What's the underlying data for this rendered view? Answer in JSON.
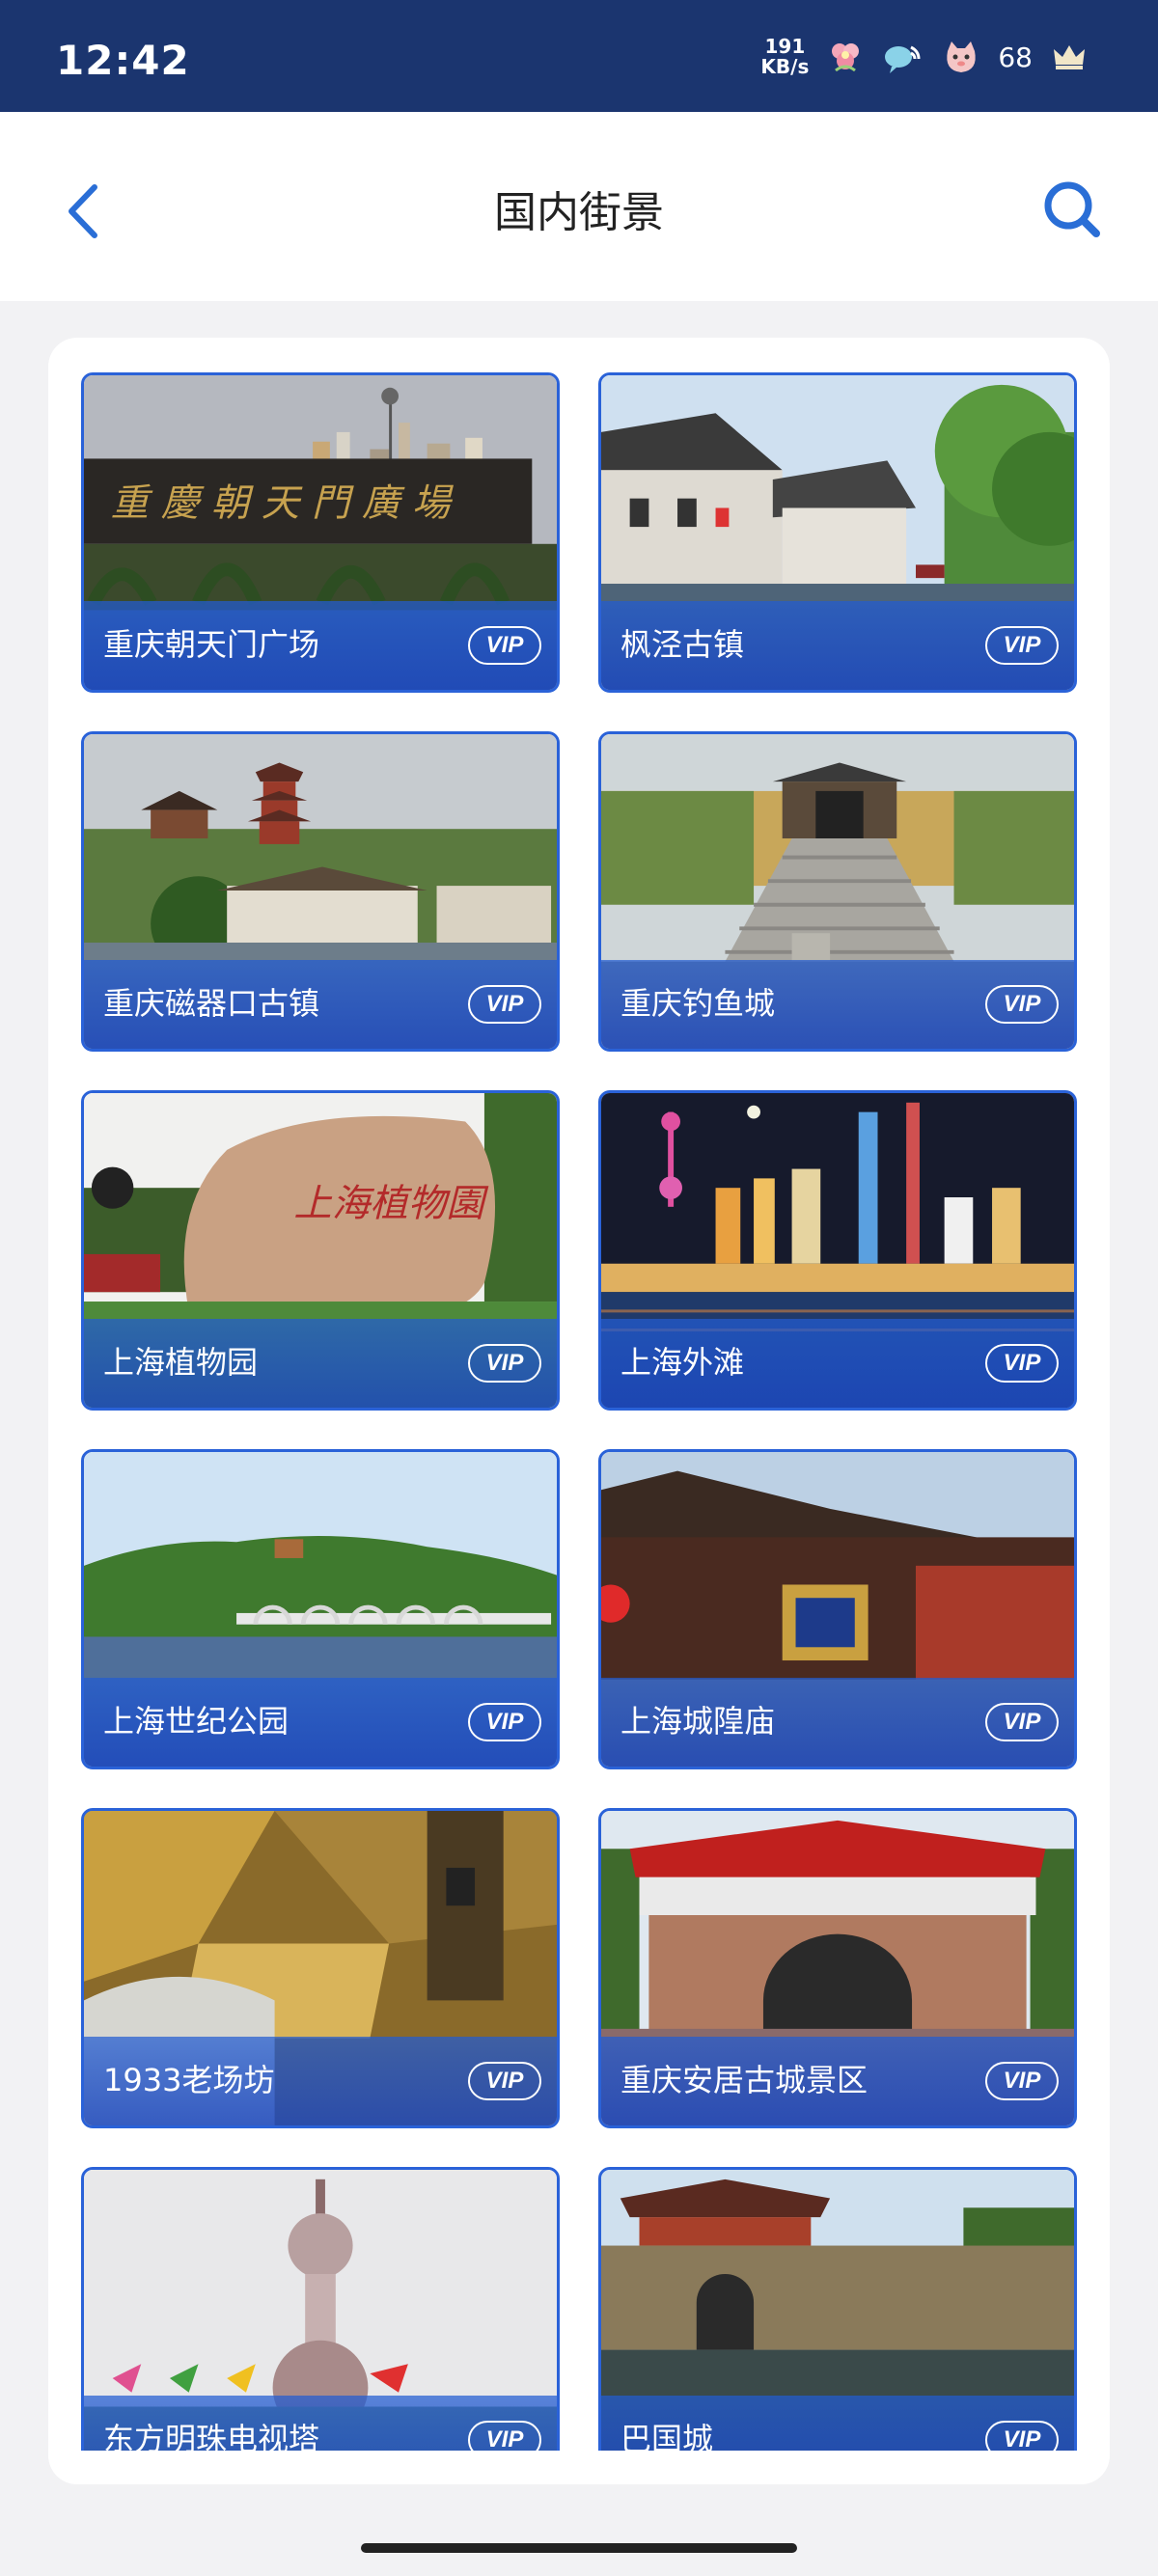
{
  "status_bar": {
    "time": "12:42",
    "net_speed_value": "191",
    "net_speed_unit": "KB/s",
    "battery": "68",
    "icons": [
      "flower-notification-icon",
      "chat-wifi-icon",
      "cat-app-icon",
      "crown-icon"
    ]
  },
  "header": {
    "title": "国内街景",
    "back_icon": "chevron-left-icon",
    "search_icon": "search-icon"
  },
  "vip_label": "VIP",
  "cards": [
    {
      "title": "重庆朝天门广场",
      "scene": "plaza"
    },
    {
      "title": "枫泾古镇",
      "scene": "watertown"
    },
    {
      "title": "重庆磁器口古镇",
      "scene": "pagoda"
    },
    {
      "title": "重庆钓鱼城",
      "scene": "gate-stairs"
    },
    {
      "title": "上海植物园",
      "scene": "rock"
    },
    {
      "title": "上海外滩",
      "scene": "skyline-night"
    },
    {
      "title": "上海世纪公园",
      "scene": "park-bridge"
    },
    {
      "title": "上海城隍庙",
      "scene": "temple"
    },
    {
      "title": "1933老场坊",
      "scene": "interior"
    },
    {
      "title": "重庆安居古城景区",
      "scene": "city-gate"
    },
    {
      "title": "东方明珠电视塔",
      "scene": "tower"
    },
    {
      "title": "巴国城",
      "scene": "fortress"
    }
  ],
  "colors": {
    "status_bar": "#1b356f",
    "accent": "#2a62d8",
    "page_bg": "#f2f2f4"
  }
}
